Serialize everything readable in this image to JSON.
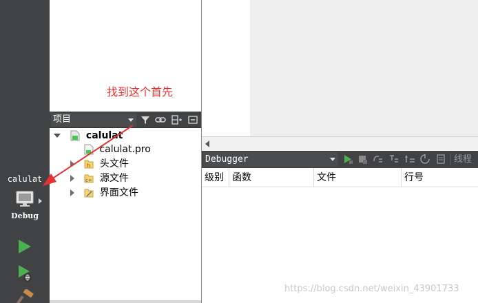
{
  "modebar": {
    "project_name": "calulat",
    "build_mode": "Debug"
  },
  "annotation": {
    "text": "找到这个首先",
    "color": "#e53333"
  },
  "project_panel": {
    "view_selector": "项目",
    "tree": [
      {
        "label": "calulat",
        "level": 0,
        "expanded": true,
        "icon": "qt-project-icon"
      },
      {
        "label": "calulat.pro",
        "level": 1,
        "icon": "pro-file-icon"
      },
      {
        "label": "头文件",
        "level": 1,
        "expanded": false,
        "icon": "header-folder-icon"
      },
      {
        "label": "源文件",
        "level": 1,
        "expanded": false,
        "icon": "source-folder-icon"
      },
      {
        "label": "界面文件",
        "level": 1,
        "expanded": false,
        "icon": "forms-folder-icon"
      }
    ]
  },
  "debugger": {
    "view_selector": "Debugger",
    "threads_label": "线程",
    "columns": [
      "级别",
      "函数",
      "文件",
      "行号"
    ]
  },
  "watermark": "https://blog.csdn.net/weixin_43901733",
  "colors": {
    "sidebar": "#404244",
    "run_green": "#4caf50"
  }
}
